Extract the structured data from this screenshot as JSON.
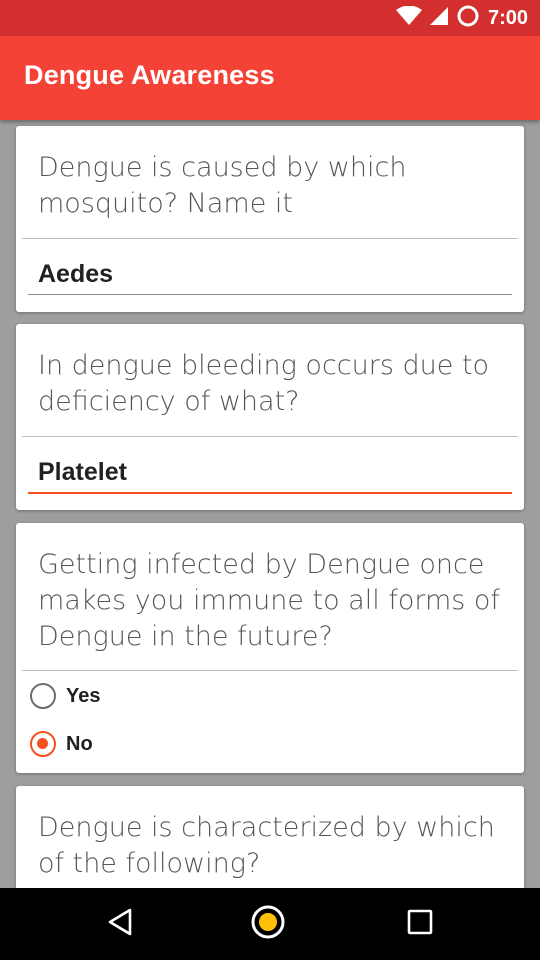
{
  "status_bar": {
    "time": "7:00",
    "icons": [
      "wifi-icon",
      "cell-signal-icon",
      "sync-circle-icon"
    ]
  },
  "app_bar": {
    "title": "Dengue Awareness"
  },
  "questions": [
    {
      "text": "Dengue is caused by which mosquito? Name it",
      "type": "text",
      "answer": "Aedes",
      "focused": false
    },
    {
      "text": "In dengue bleeding occurs due to deficiency of what?",
      "type": "text",
      "answer": "Platelet",
      "focused": true
    },
    {
      "text": "Getting infected by Dengue once makes you immune to all forms of Dengue in the future?",
      "type": "radio",
      "options": [
        {
          "label": "Yes",
          "checked": false
        },
        {
          "label": "No",
          "checked": true
        }
      ]
    },
    {
      "text": "Dengue is characterized by which of the following?",
      "type": "partial"
    }
  ],
  "colors": {
    "status_bar": "#d32f2f",
    "app_bar": "#f44336",
    "accent": "#f4511e",
    "background": "#9e9e9e"
  },
  "nav_bar": {
    "icons": [
      "back-triangle-icon",
      "home-circle-icon",
      "recents-square-icon"
    ]
  }
}
